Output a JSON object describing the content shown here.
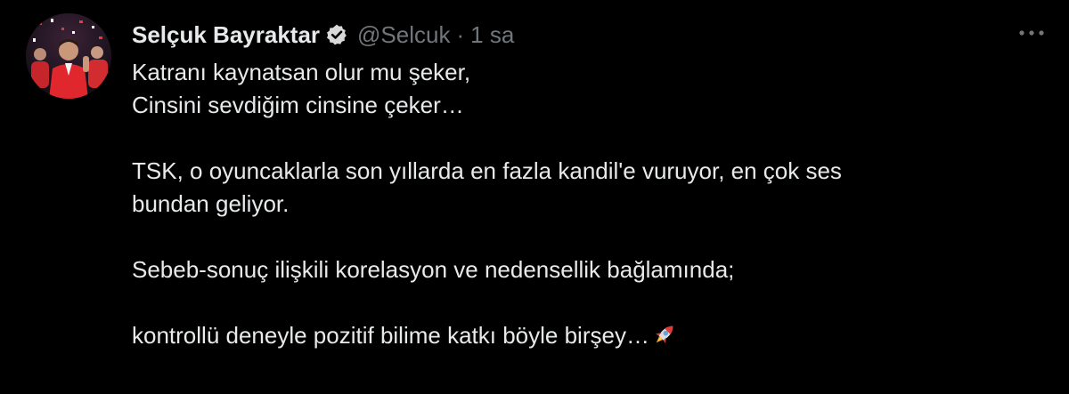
{
  "tweet": {
    "author": {
      "display_name": "Selçuk Bayraktar",
      "handle": "@Selcuk",
      "verified": true,
      "avatar": "profile-photo"
    },
    "separator": "·",
    "timestamp": "1 sa",
    "more_icon": "more-dots-icon",
    "lines": [
      "Katranı kaynatsan olur mu şeker,",
      "Cinsini sevdiğim cinsine çeker…",
      "",
      "TSK, o oyuncaklarla son yıllarda en fazla kandil'e vuruyor, en çok ses",
      "bundan geliyor.",
      "",
      "Sebeb-sonuç ilişkili korelasyon ve nedensellik bağlamında;",
      "",
      "kontrollü deneyle pozitif bilime katkı böyle birşey…"
    ],
    "trailing_emoji": "rocket-icon"
  },
  "colors": {
    "background": "#000000",
    "text_primary": "#e7e9ea",
    "text_secondary": "#71767b",
    "verified_badge": "#d9d9d9"
  }
}
